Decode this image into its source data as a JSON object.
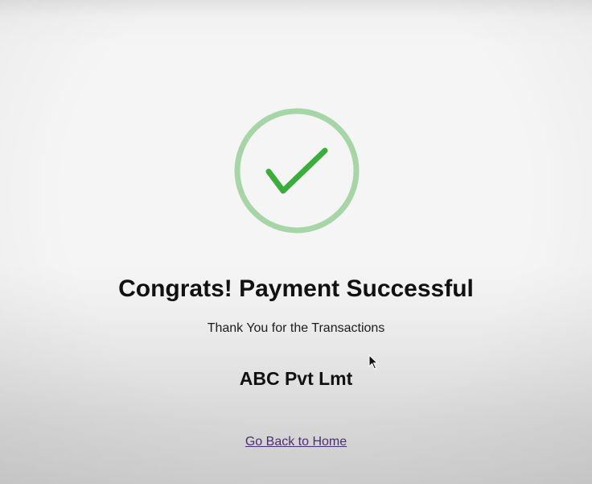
{
  "colors": {
    "ring": "#a6d5a6",
    "check": "#3aae3a",
    "title_text": "#111111",
    "link": "#4a2f6e"
  },
  "success": {
    "icon": "checkmark-circle-icon",
    "title": "Congrats! Payment Successful",
    "message": "Thank You for the Transactions",
    "company": "ABC Pvt Lmt",
    "home_link_label": "Go Back to Home"
  },
  "cursor": {
    "icon": "mouse-pointer-icon"
  }
}
